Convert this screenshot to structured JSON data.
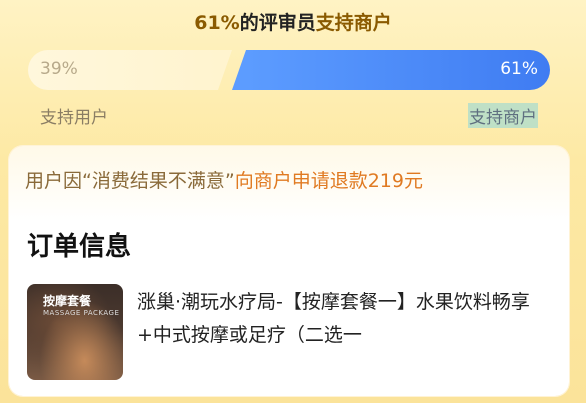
{
  "header": {
    "percent": "61%",
    "middle": "的评审员",
    "tail": "支持商户"
  },
  "vote_bar": {
    "left_percent": "39%",
    "right_percent": "61%",
    "left_fraction": 0.39,
    "right_fraction": 0.61,
    "left_color": "#fff4cf",
    "right_color": "#4a86f7"
  },
  "legend": {
    "left_label": "支持用户",
    "right_label": "支持商户"
  },
  "card": {
    "refund_prefix": "用户因“消费结果不满意”",
    "refund_suffix": "向商户申请退款219元",
    "section_title": "订单信息",
    "thumb_title": "按摩套餐",
    "thumb_subtitle": "MASSAGE PACKAGE",
    "product_name": "涨巢·潮玩水疗局-【按摩套餐一】水果饮料畅享+中式按摩或足疗（二选一"
  }
}
